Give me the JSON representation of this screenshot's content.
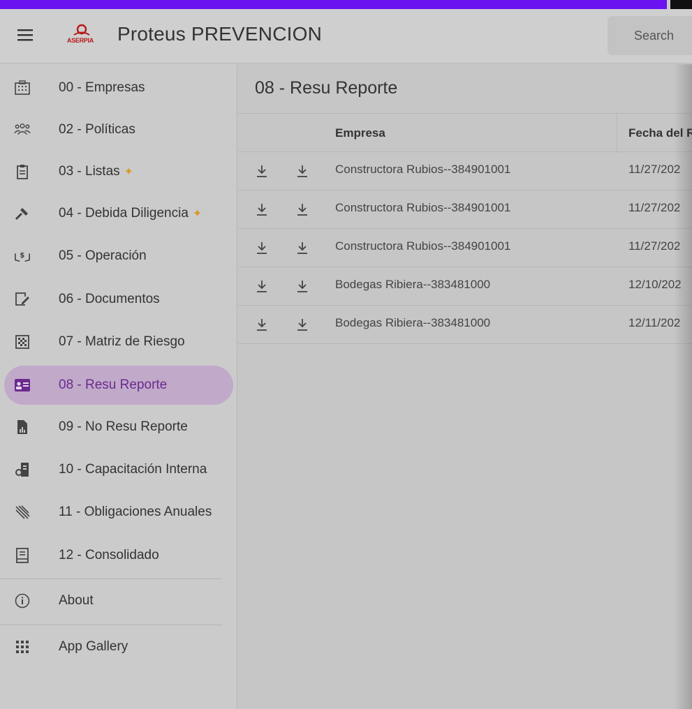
{
  "app": {
    "title": "Proteus PREVENCION",
    "logo_text": "ASERPIA"
  },
  "search": {
    "placeholder": "Search"
  },
  "sidebar": {
    "items": [
      {
        "label": "00 - Empresas",
        "icon": "building-icon",
        "starred": false
      },
      {
        "label": "02 - Políticas",
        "icon": "group-icon",
        "starred": false
      },
      {
        "label": "03 - Listas",
        "icon": "clipboard-icon",
        "starred": true
      },
      {
        "label": "04 - Debida Diligencia",
        "icon": "gavel-icon",
        "starred": true
      },
      {
        "label": "05 - Operación",
        "icon": "money-hand-icon",
        "starred": false
      },
      {
        "label": "06 - Documentos",
        "icon": "edit-document-icon",
        "starred": false
      },
      {
        "label": "07 - Matriz de Riesgo",
        "icon": "grid-icon",
        "starred": false
      },
      {
        "label": "08 - Resu Reporte",
        "icon": "id-card-icon",
        "starred": false,
        "active": true
      },
      {
        "label": "09 - No Resu Reporte",
        "icon": "report-chart-icon",
        "starred": false
      },
      {
        "label": "10 - Capacitación Interna",
        "icon": "training-icon",
        "starred": false
      },
      {
        "label": "11 - Obligaciones Anuales",
        "icon": "stripes-icon",
        "starred": false
      },
      {
        "label": "12 - Consolidado",
        "icon": "book-icon",
        "starred": false
      }
    ],
    "about": "About",
    "app_gallery": "App Gallery"
  },
  "main": {
    "title": "08 - Resu Reporte",
    "columns": [
      "Empresa",
      "Fecha del R"
    ],
    "rows": [
      {
        "empresa": "Constructora Rubios--384901001",
        "fecha": "11/27/202"
      },
      {
        "empresa": "Constructora Rubios--384901001",
        "fecha": "11/27/202"
      },
      {
        "empresa": "Constructora Rubios--384901001",
        "fecha": "11/27/202"
      },
      {
        "empresa": "Bodegas Ribiera--383481000",
        "fecha": "12/10/202"
      },
      {
        "empresa": "Bodegas Ribiera--383481000",
        "fecha": "12/11/202"
      }
    ]
  },
  "colors": {
    "accent": "#6a12f0",
    "active_bg": "#c1a9c9",
    "active_text": "#6a2a8e",
    "logo": "#b81b1b",
    "star": "#d89a2a"
  }
}
